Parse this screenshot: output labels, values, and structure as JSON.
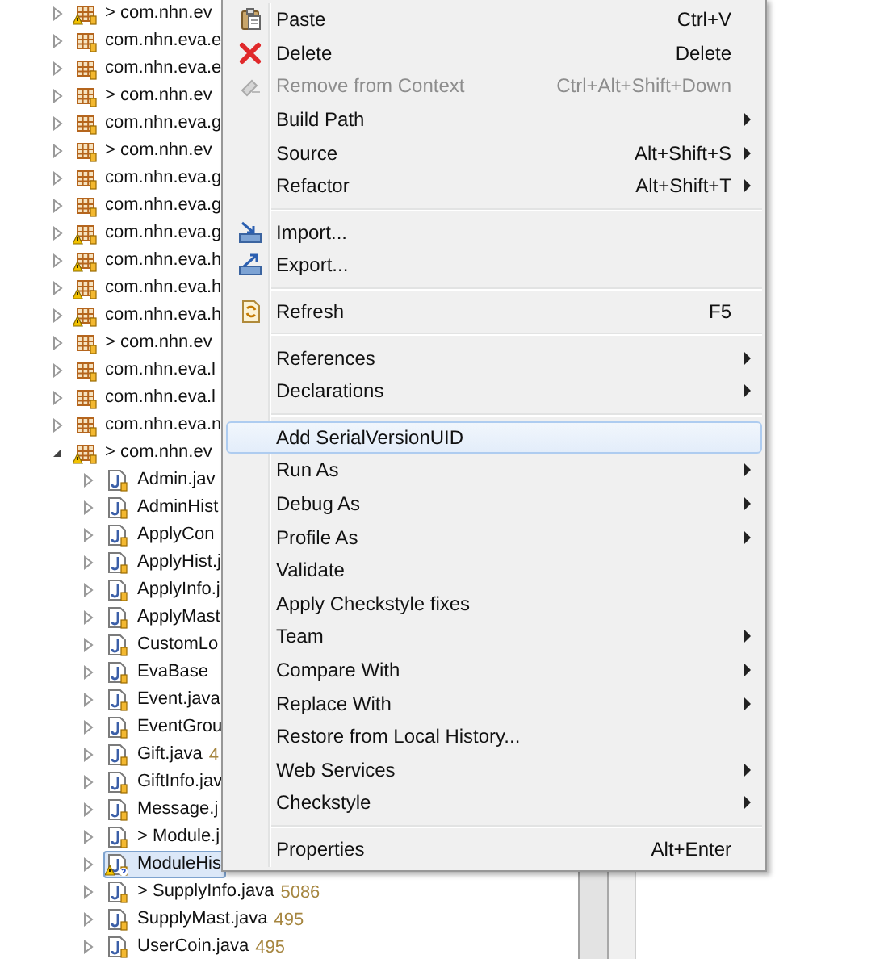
{
  "tree": {
    "packages": [
      {
        "label": "> com.nhn.ev",
        "warning": true,
        "expanded": false
      },
      {
        "label": "com.nhn.eva.e",
        "warning": false,
        "expanded": false
      },
      {
        "label": "com.nhn.eva.e",
        "warning": false,
        "expanded": false
      },
      {
        "label": "> com.nhn.ev",
        "warning": false,
        "expanded": false
      },
      {
        "label": "com.nhn.eva.g",
        "warning": false,
        "expanded": false
      },
      {
        "label": "> com.nhn.ev",
        "warning": false,
        "expanded": false
      },
      {
        "label": "com.nhn.eva.g",
        "warning": false,
        "expanded": false
      },
      {
        "label": "com.nhn.eva.g",
        "warning": false,
        "expanded": false
      },
      {
        "label": "com.nhn.eva.g",
        "warning": true,
        "expanded": false
      },
      {
        "label": "com.nhn.eva.h",
        "warning": true,
        "expanded": false
      },
      {
        "label": "com.nhn.eva.h",
        "warning": true,
        "expanded": false
      },
      {
        "label": "com.nhn.eva.h",
        "warning": true,
        "expanded": false
      },
      {
        "label": "> com.nhn.ev",
        "warning": false,
        "expanded": false
      },
      {
        "label": "com.nhn.eva.l",
        "warning": false,
        "expanded": false
      },
      {
        "label": "com.nhn.eva.l",
        "warning": false,
        "expanded": false
      },
      {
        "label": "com.nhn.eva.n",
        "warning": false,
        "expanded": false
      },
      {
        "label": "> com.nhn.ev",
        "warning": true,
        "expanded": true,
        "children": [
          {
            "label": "Admin.jav",
            "warning": false,
            "selected": false
          },
          {
            "label": "AdminHist",
            "warning": false,
            "selected": false
          },
          {
            "label": "ApplyCon",
            "warning": false,
            "selected": false
          },
          {
            "label": "ApplyHist.j",
            "warning": false,
            "selected": false
          },
          {
            "label": "ApplyInfo.j",
            "warning": false,
            "selected": false
          },
          {
            "label": "ApplyMast",
            "warning": false,
            "selected": false
          },
          {
            "label": "CustomLo",
            "warning": false,
            "selected": false
          },
          {
            "label": "EvaBase",
            "warning": false,
            "selected": false
          },
          {
            "label": "Event.java",
            "warning": false,
            "selected": false
          },
          {
            "label": "EventGrou",
            "warning": false,
            "selected": false
          },
          {
            "label": "Gift.java",
            "version": "4",
            "warning": false,
            "selected": false
          },
          {
            "label": "GiftInfo.jav",
            "warning": false,
            "selected": false
          },
          {
            "label": "Message.j",
            "warning": false,
            "selected": false
          },
          {
            "label": "> Module.j",
            "warning": false,
            "selected": false
          },
          {
            "label": "ModuleHis",
            "warning": true,
            "selected": true
          },
          {
            "label": "> SupplyInfo.java",
            "version": "5086",
            "warning": false,
            "selected": false
          },
          {
            "label": "SupplyMast.java",
            "version": "495",
            "warning": false,
            "selected": false
          },
          {
            "label": "UserCoin.java",
            "version": "495",
            "warning": false,
            "selected": false
          }
        ]
      }
    ]
  },
  "context_menu": {
    "items": [
      {
        "kind": "item",
        "label": "Paste",
        "shortcut": "Ctrl+V",
        "submenu": false,
        "disabled": false,
        "selected": false
      },
      {
        "kind": "item",
        "label": "Delete",
        "shortcut": "Delete",
        "submenu": false,
        "disabled": false,
        "selected": false
      },
      {
        "kind": "item",
        "label": "Remove from Context",
        "shortcut": "Ctrl+Alt+Shift+Down",
        "submenu": false,
        "disabled": true,
        "selected": false
      },
      {
        "kind": "item",
        "label": "Build Path",
        "submenu": true,
        "disabled": false,
        "selected": false
      },
      {
        "kind": "item",
        "label": "Source",
        "shortcut": "Alt+Shift+S",
        "submenu": true,
        "disabled": false,
        "selected": false
      },
      {
        "kind": "item",
        "label": "Refactor",
        "shortcut": "Alt+Shift+T",
        "submenu": true,
        "disabled": false,
        "selected": false
      },
      {
        "kind": "separator"
      },
      {
        "kind": "item",
        "label": "Import...",
        "submenu": false,
        "disabled": false,
        "selected": false
      },
      {
        "kind": "item",
        "label": "Export...",
        "submenu": false,
        "disabled": false,
        "selected": false
      },
      {
        "kind": "separator"
      },
      {
        "kind": "item",
        "label": "Refresh",
        "shortcut": "F5",
        "submenu": false,
        "disabled": false,
        "selected": false
      },
      {
        "kind": "separator"
      },
      {
        "kind": "item",
        "label": "References",
        "submenu": true,
        "disabled": false,
        "selected": false
      },
      {
        "kind": "item",
        "label": "Declarations",
        "submenu": true,
        "disabled": false,
        "selected": false
      },
      {
        "kind": "separator"
      },
      {
        "kind": "item",
        "label": "Add SerialVersionUID",
        "submenu": false,
        "disabled": false,
        "selected": true
      },
      {
        "kind": "item",
        "label": "Run As",
        "submenu": true,
        "disabled": false,
        "selected": false
      },
      {
        "kind": "item",
        "label": "Debug As",
        "submenu": true,
        "disabled": false,
        "selected": false
      },
      {
        "kind": "item",
        "label": "Profile As",
        "submenu": true,
        "disabled": false,
        "selected": false
      },
      {
        "kind": "item",
        "label": "Validate",
        "submenu": false,
        "disabled": false,
        "selected": false
      },
      {
        "kind": "item",
        "label": "Apply Checkstyle fixes",
        "submenu": false,
        "disabled": false,
        "selected": false
      },
      {
        "kind": "item",
        "label": "Team",
        "submenu": true,
        "disabled": false,
        "selected": false
      },
      {
        "kind": "item",
        "label": "Compare With",
        "submenu": true,
        "disabled": false,
        "selected": false
      },
      {
        "kind": "item",
        "label": "Replace With",
        "submenu": true,
        "disabled": false,
        "selected": false
      },
      {
        "kind": "item",
        "label": "Restore from Local History...",
        "submenu": false,
        "disabled": false,
        "selected": false
      },
      {
        "kind": "item",
        "label": "Web Services",
        "submenu": true,
        "disabled": false,
        "selected": false
      },
      {
        "kind": "item",
        "label": "Checkstyle",
        "submenu": true,
        "disabled": false,
        "selected": false
      },
      {
        "kind": "separator"
      },
      {
        "kind": "item",
        "label": "Properties",
        "shortcut": "Alt+Enter",
        "submenu": false,
        "disabled": false,
        "selected": false
      }
    ]
  }
}
